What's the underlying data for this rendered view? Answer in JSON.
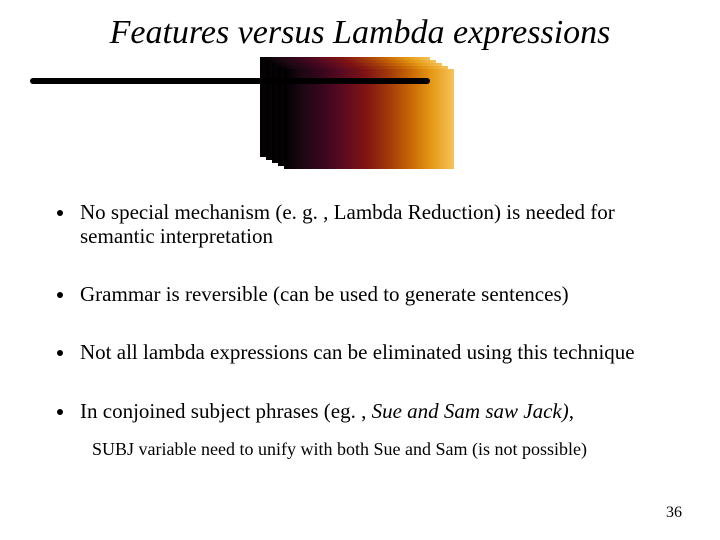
{
  "slide": {
    "title": "Features versus Lambda expressions",
    "bullets": [
      "No special mechanism (e. g. , Lambda Reduction)  is needed for semantic interpretation",
      "Grammar is reversible (can be used to generate sentences)",
      "Not all lambda expressions can be eliminated using this technique"
    ],
    "bullet4_pre": "In conjoined subject phrases (eg. , ",
    "bullet4_ital": "Sue and Sam saw Jack),",
    "subnote": "SUBJ variable need to unify with both Sue and Sam (is not possible)",
    "page_number": "36"
  }
}
